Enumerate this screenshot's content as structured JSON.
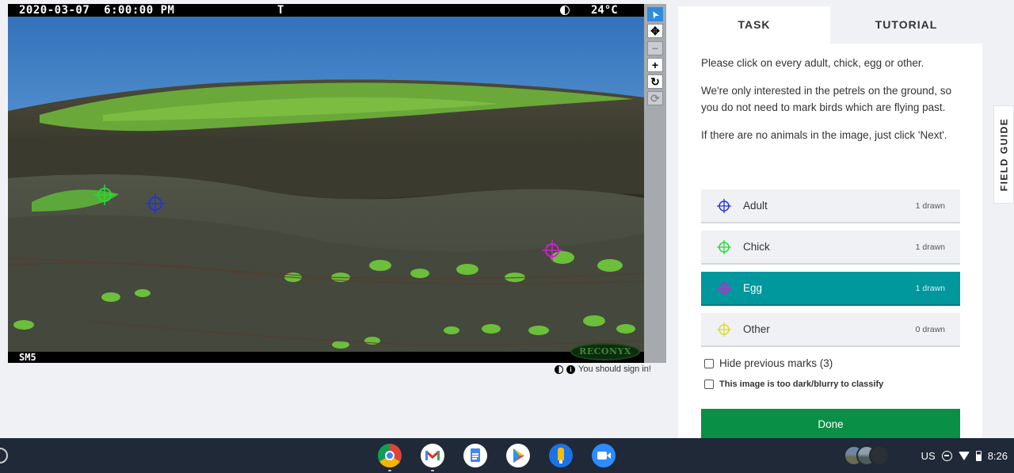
{
  "camera": {
    "datetime": "2020-03-07  6:00:00 PM",
    "flag": "T",
    "temperature": "24°C",
    "station": "SM5",
    "brand": "RECONYX"
  },
  "toolbar": {
    "tools": [
      {
        "name": "pointer-tool",
        "icon": "arrow-pointer-icon",
        "glyph": "➤"
      },
      {
        "name": "move-tool",
        "icon": "move-icon",
        "glyph": "✥"
      },
      {
        "name": "zoom-out-tool",
        "icon": "minus-icon",
        "glyph": "−"
      },
      {
        "name": "zoom-in-tool",
        "icon": "plus-icon",
        "glyph": "+"
      },
      {
        "name": "rotate-tool",
        "icon": "rotate-icon",
        "glyph": "↻"
      },
      {
        "name": "reset-tool",
        "icon": "refresh-icon",
        "glyph": "⟳"
      }
    ]
  },
  "signin": {
    "text": "You should sign in!"
  },
  "tabs": [
    {
      "label": "TASK"
    },
    {
      "label": "TUTORIAL"
    }
  ],
  "instructions": [
    "Please click on every adult, chick, egg or other.",
    "We're only interested in the petrels on the ground, so you do not need to mark birds which are flying past.",
    "If there are no animals in the image, just click 'Next'."
  ],
  "choices": [
    {
      "label": "Adult",
      "count": "1 drawn",
      "color": "#2233dd",
      "selected": false
    },
    {
      "label": "Chick",
      "count": "1 drawn",
      "color": "#22dd33",
      "selected": false
    },
    {
      "label": "Egg",
      "count": "1 drawn",
      "color": "#cc22cc",
      "selected": true
    },
    {
      "label": "Other",
      "count": "0 drawn",
      "color": "#dddd22",
      "selected": false
    }
  ],
  "options": {
    "hide_marks": "Hide previous marks (3)",
    "too_dark": "This image is too dark/blurry to classify"
  },
  "done_label": "Done",
  "field_guide_label": "FIELD GUIDE",
  "shelf": {
    "apps": [
      "chrome-icon",
      "gmail-icon",
      "docs-icon",
      "play-store-icon",
      "keep-icon",
      "zoom-icon"
    ],
    "locale": "US",
    "time": "8:26"
  }
}
